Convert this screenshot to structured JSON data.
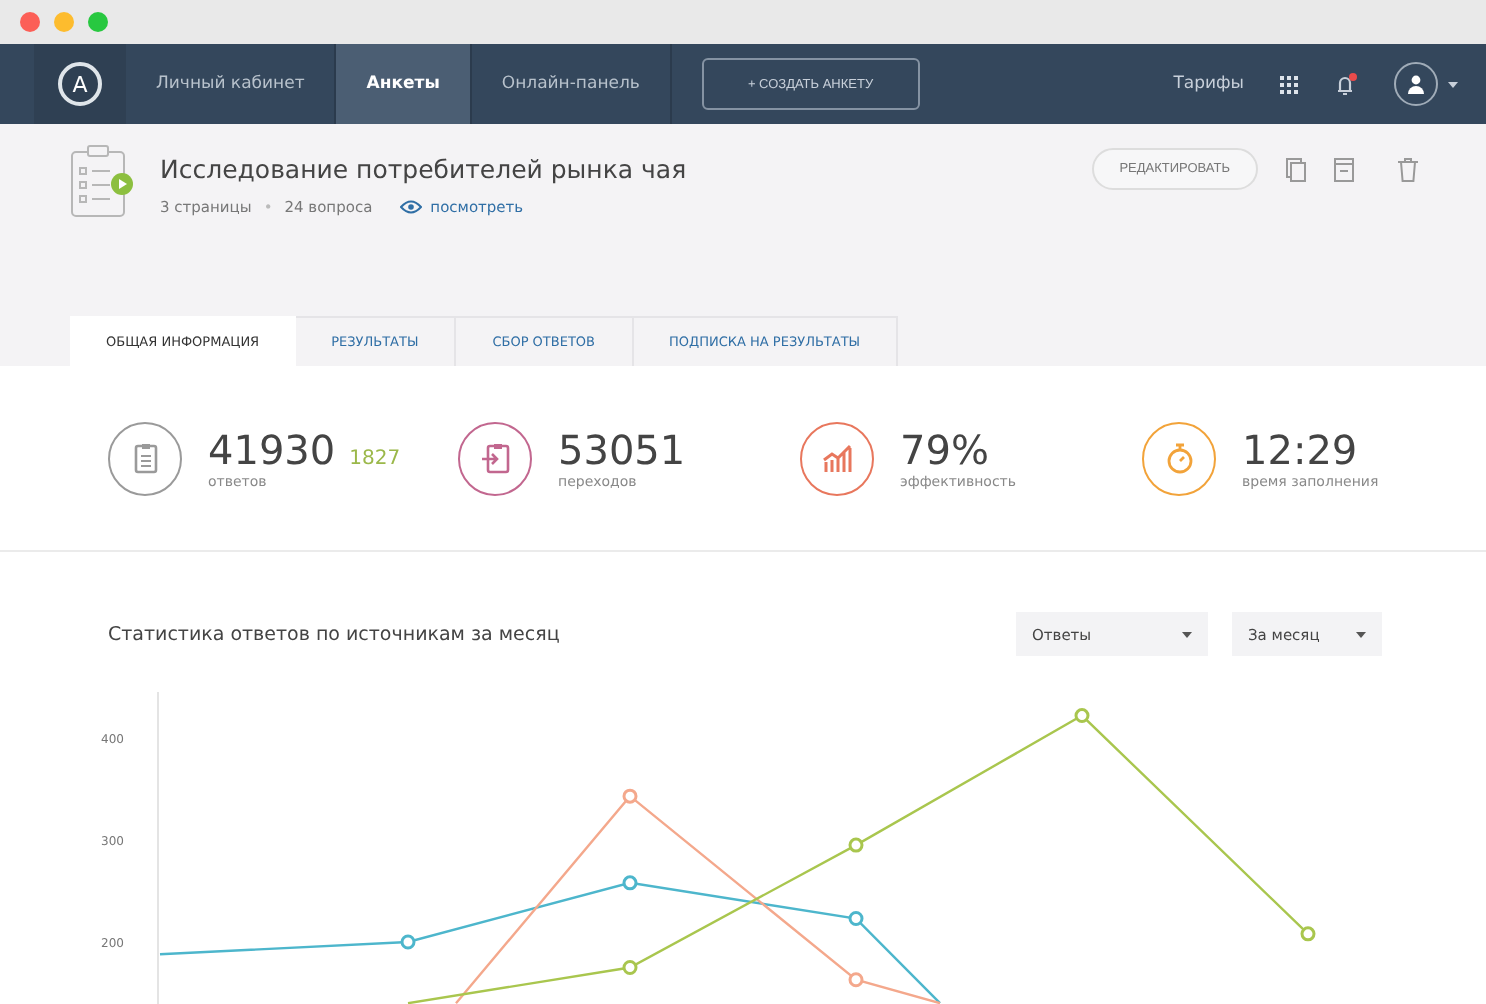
{
  "nav": {
    "logo": "A",
    "items": [
      {
        "label": "Личный кабинет",
        "selected": false
      },
      {
        "label": "Анкеты",
        "selected": true
      },
      {
        "label": "Онлайн-панель",
        "selected": false
      }
    ],
    "create_button": "+ СОЗДАТЬ АНКЕТУ",
    "pricing": "Тарифы"
  },
  "survey": {
    "title": "Исследование потребителей рынка чая",
    "pages": "3 страницы",
    "separator": "•",
    "questions": "24 вопроса",
    "view_link": "посмотреть",
    "edit_button": "РЕДАКТИРОВАТЬ"
  },
  "tabs": [
    {
      "label": "ОБЩАЯ ИНФОРМАЦИЯ",
      "selected": true
    },
    {
      "label": "РЕЗУЛЬТАТЫ",
      "selected": false
    },
    {
      "label": "СБОР ОТВЕТОВ",
      "selected": false
    },
    {
      "label": "ПОДПИСКА НА РЕЗУЛЬТАТЫ",
      "selected": false
    }
  ],
  "stats": [
    {
      "kind": "answers",
      "value": "41930",
      "extra": "1827",
      "label": "ответов",
      "color": "#9a9a9a"
    },
    {
      "kind": "transitions",
      "value": "53051",
      "label": "переходов",
      "color": "#c2678f"
    },
    {
      "kind": "efficiency",
      "value": "79%",
      "label": "эффективность",
      "color": "#e8775d"
    },
    {
      "kind": "time",
      "value": "12:29",
      "label": "время заполнения",
      "color": "#f2a33a"
    }
  ],
  "chart_section": {
    "title": "Статистика ответов по источникам за месяц",
    "filters": [
      "Ответы",
      "За месяц"
    ],
    "y_axis_labels": [
      "400",
      "300",
      "200"
    ]
  }
}
